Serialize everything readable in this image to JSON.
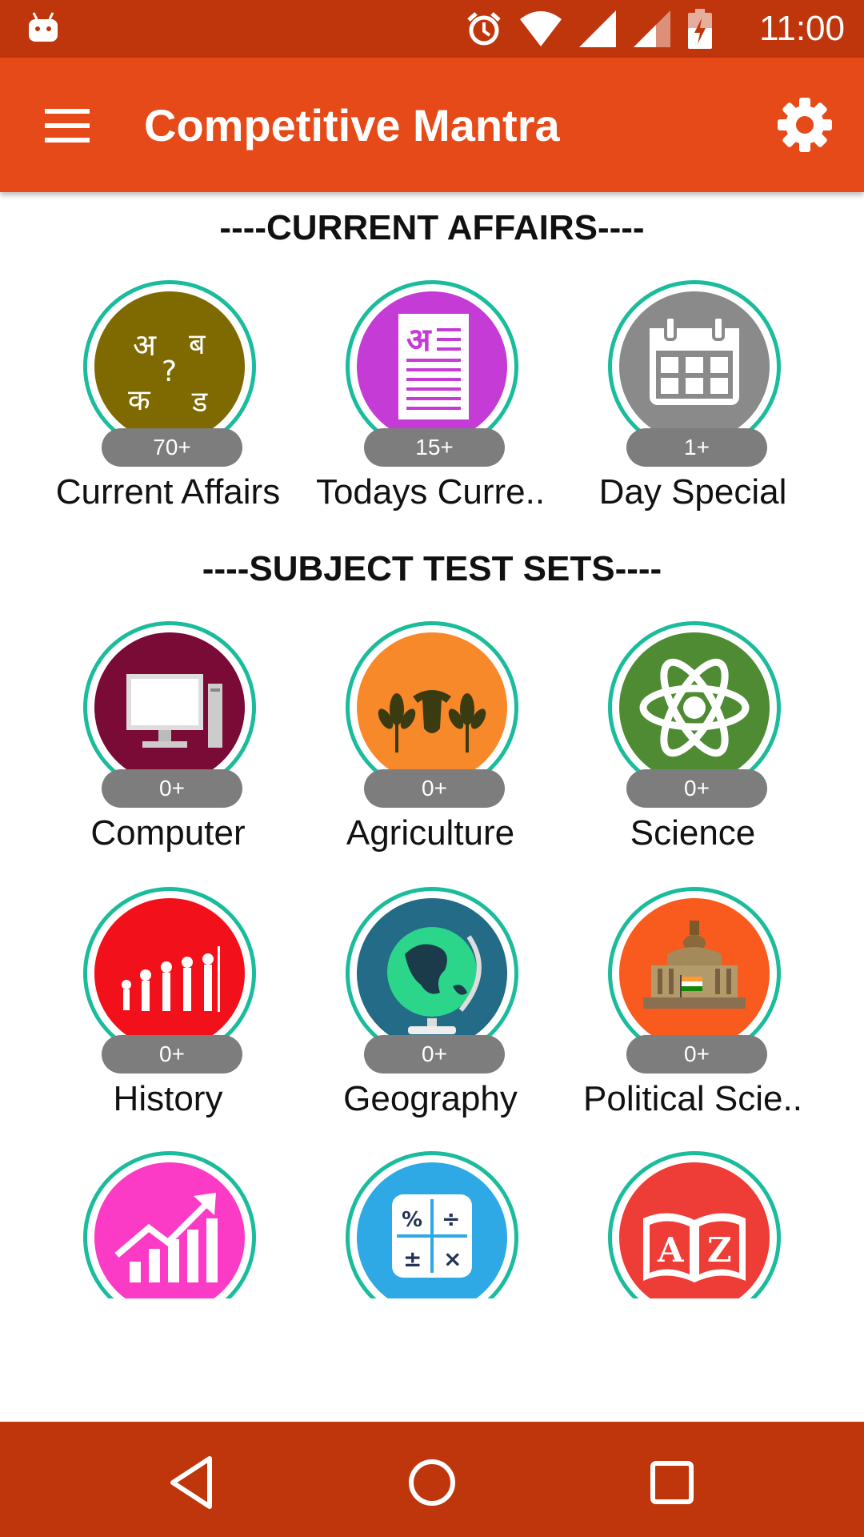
{
  "status_bar": {
    "time": "11:00",
    "icons": [
      "android-icon",
      "alarm-icon",
      "wifi-icon",
      "signal-icon",
      "signal-weak-icon",
      "battery-icon"
    ]
  },
  "app_bar": {
    "title": "Competitive Mantra",
    "menu_icon": "hamburger-icon",
    "settings_icon": "gear-icon",
    "color": "#E64A19"
  },
  "sections": {
    "current_affairs": {
      "title": "----CURRENT AFFAIRS----",
      "items": [
        {
          "label": "Current Affairs",
          "badge": "70+",
          "icon": "hindi-letters-icon",
          "color": "#7E6A00"
        },
        {
          "label": "Todays Curre..",
          "badge": "15+",
          "icon": "hindi-document-icon",
          "color": "#C53BD6"
        },
        {
          "label": "Day Special",
          "badge": "1+",
          "icon": "calendar-icon",
          "color": "#8A8A8A"
        }
      ]
    },
    "subject_test_sets": {
      "title": "----SUBJECT TEST SETS----",
      "items": [
        {
          "label": "Computer",
          "badge": "0+",
          "icon": "computer-icon",
          "color": "#7A0A36"
        },
        {
          "label": "Agriculture",
          "badge": "0+",
          "icon": "agriculture-icon",
          "color": "#F8892A"
        },
        {
          "label": "Science",
          "badge": "0+",
          "icon": "atom-icon",
          "color": "#4E8B33"
        },
        {
          "label": "History",
          "badge": "0+",
          "icon": "evolution-icon",
          "color": "#F2111A"
        },
        {
          "label": "Geography",
          "badge": "0+",
          "icon": "globe-icon",
          "color": "#236B86"
        },
        {
          "label": "Political Scie..",
          "badge": "0+",
          "icon": "emblem-icon",
          "color": "#F95A1E"
        },
        {
          "label": "",
          "badge": "",
          "icon": "growth-chart-icon",
          "color": "#FB3BC6"
        },
        {
          "label": "",
          "badge": "",
          "icon": "calculator-icon",
          "color": "#2EA9E6"
        },
        {
          "label": "",
          "badge": "",
          "icon": "dictionary-icon",
          "color": "#EE3C36"
        }
      ]
    }
  },
  "ring_color": "#1ABC9C",
  "nav_bar": {
    "buttons": [
      "back-icon",
      "home-icon",
      "recents-icon"
    ]
  }
}
